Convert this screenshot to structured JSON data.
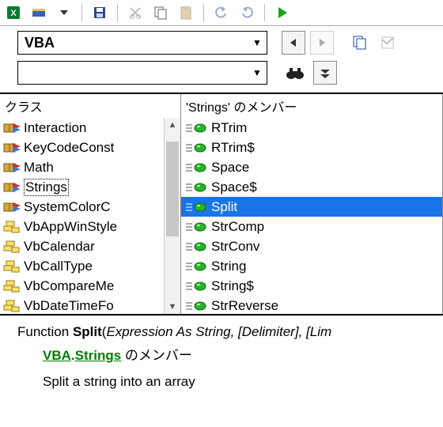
{
  "toolbar_icons": [
    "excel",
    "ruler",
    "",
    "save",
    "",
    "cut",
    "copy",
    "paste",
    "",
    "undo",
    "redo",
    "",
    "run"
  ],
  "library": {
    "value": "VBA"
  },
  "search": {
    "value": ""
  },
  "nav": {
    "back_enabled": false,
    "fwd_enabled": false
  },
  "panes": {
    "left": {
      "header": "クラス",
      "items": [
        {
          "kind": "lib",
          "label": "Interaction"
        },
        {
          "kind": "lib",
          "label": "KeyCodeConst"
        },
        {
          "kind": "lib",
          "label": "Math"
        },
        {
          "kind": "lib",
          "label": "Strings",
          "dotbox": true
        },
        {
          "kind": "lib",
          "label": "SystemColorC"
        },
        {
          "kind": "enum",
          "label": "VbAppWinStyle"
        },
        {
          "kind": "enum",
          "label": "VbCalendar"
        },
        {
          "kind": "enum",
          "label": "VbCallType"
        },
        {
          "kind": "enum",
          "label": "VbCompareMe"
        },
        {
          "kind": "enum",
          "label": "VbDateTimeFo"
        }
      ]
    },
    "right": {
      "header": "'Strings' のメンバー",
      "items": [
        {
          "label": "RTrim"
        },
        {
          "label": "RTrim$"
        },
        {
          "label": "Space"
        },
        {
          "label": "Space$"
        },
        {
          "label": "Split",
          "selected": true
        },
        {
          "label": "StrComp"
        },
        {
          "label": "StrConv"
        },
        {
          "label": "String"
        },
        {
          "label": "String$"
        },
        {
          "label": "StrReverse"
        }
      ]
    }
  },
  "detail": {
    "keyword": "Function",
    "name": "Split",
    "args_preview": "Expression As String, [Delimiter], [Lim",
    "open_paren": "(",
    "lib": "VBA",
    "module": "Strings",
    "member_suffix": " のメンバー",
    "dot": ".",
    "description": "Split a string into an array"
  }
}
